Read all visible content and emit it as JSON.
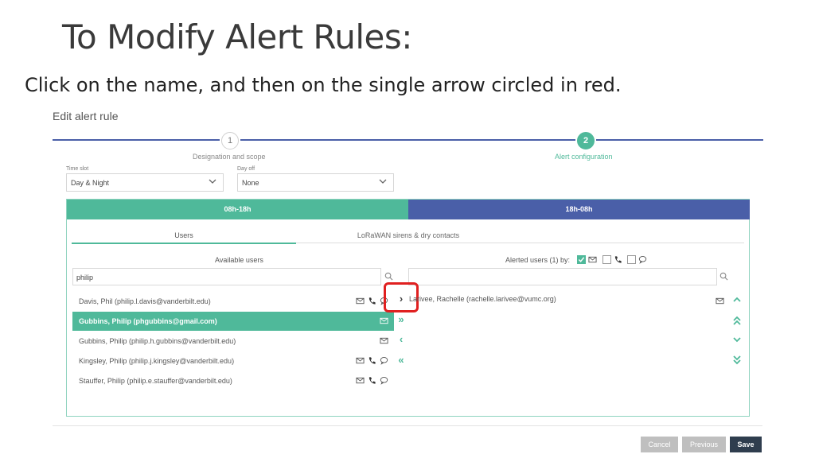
{
  "slide": {
    "title": "To Modify Alert Rules:",
    "subtitle": "Click on the name, and then on the single arrow circled in red."
  },
  "dialog": {
    "title": "Edit alert rule",
    "steps": [
      {
        "number": "1",
        "label": "Designation and scope"
      },
      {
        "number": "2",
        "label": "Alert configuration"
      }
    ]
  },
  "fields": {
    "time_slot": {
      "label": "Time slot",
      "value": "Day & Night"
    },
    "day_off": {
      "label": "Day off",
      "value": "None"
    }
  },
  "tabs": {
    "day": "08h-18h",
    "night": "18h-08h"
  },
  "subtabs": {
    "users": "Users",
    "lorawan": "LoRaWAN sirens & dry contacts"
  },
  "available": {
    "header": "Available users",
    "search_value": "philip",
    "users": [
      {
        "name": "Davis, Phil (philip.l.davis@vanderbilt.edu)",
        "icons": [
          "mail-icon",
          "phone-icon",
          "chat-icon"
        ]
      },
      {
        "name": "Gubbins, Philip (phgubbins@gmail.com)",
        "icons": [
          "mail-icon"
        ],
        "selected": true
      },
      {
        "name": "Gubbins, Philip (philip.h.gubbins@vanderbilt.edu)",
        "icons": [
          "mail-icon"
        ]
      },
      {
        "name": "Kingsley, Philip (philip.j.kingsley@vanderbilt.edu)",
        "icons": [
          "mail-icon",
          "phone-icon",
          "chat-icon"
        ]
      },
      {
        "name": "Stauffer, Philip (philip.e.stauffer@vanderbilt.edu)",
        "icons": [
          "mail-icon",
          "phone-icon",
          "chat-icon"
        ]
      }
    ]
  },
  "alerted": {
    "header": "Alerted users (1) by:",
    "checkboxes": [
      {
        "icon": "mail-icon",
        "checked": true
      },
      {
        "icon": "phone-icon",
        "checked": false
      },
      {
        "icon": "chat-icon",
        "checked": false
      }
    ],
    "search_value": "",
    "users": [
      {
        "name": "Larivee, Rachelle (rachelle.larivee@vumc.org)",
        "icons": [
          "mail-icon"
        ]
      }
    ]
  },
  "transfer": {
    "add_one": "›",
    "add_all": "»",
    "remove_one": "‹",
    "remove_all": "«"
  },
  "order": {
    "up": "︿",
    "top": "⌃⌃",
    "down": "﹀",
    "bottom": "⌄⌄"
  },
  "buttons": {
    "cancel": "Cancel",
    "previous": "Previous",
    "save": "Save"
  },
  "colors": {
    "accent_green": "#4fb99a",
    "accent_blue": "#4a5fa8",
    "highlight_red": "#e02020"
  }
}
